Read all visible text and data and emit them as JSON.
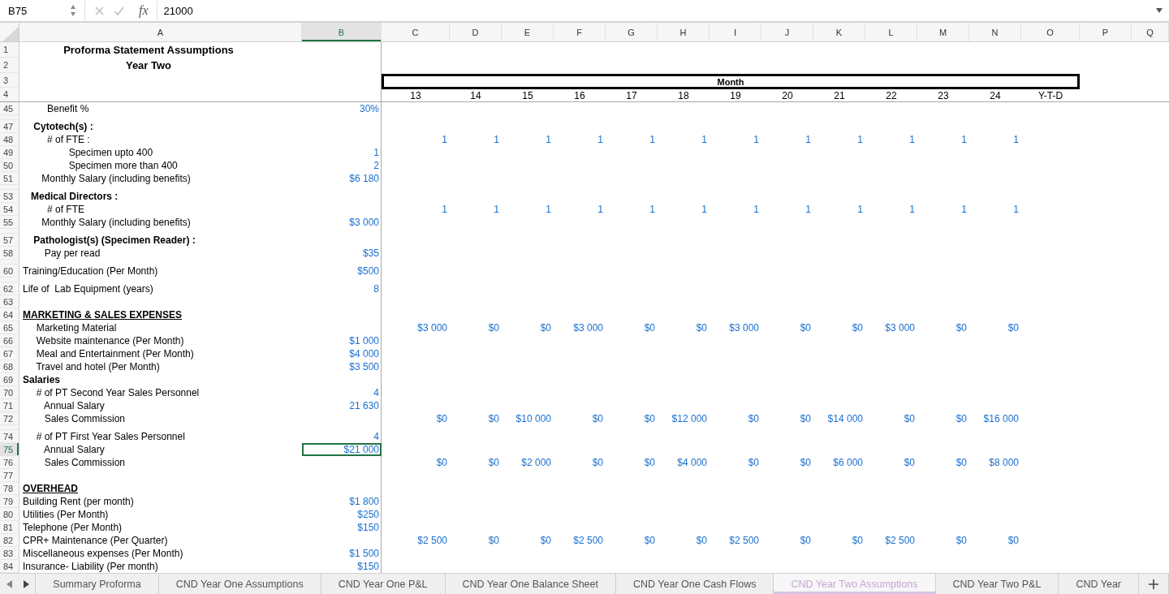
{
  "formula_bar": {
    "cell_ref": "B75",
    "fx_label": "fx",
    "formula": "21000"
  },
  "columns": [
    {
      "label": "A",
      "selected": false
    },
    {
      "label": "B",
      "selected": true
    },
    {
      "label": "C",
      "selected": false
    },
    {
      "label": "D",
      "selected": false
    },
    {
      "label": "E",
      "selected": false
    },
    {
      "label": "F",
      "selected": false
    },
    {
      "label": "G",
      "selected": false
    },
    {
      "label": "H",
      "selected": false
    },
    {
      "label": "I",
      "selected": false
    },
    {
      "label": "J",
      "selected": false
    },
    {
      "label": "K",
      "selected": false
    },
    {
      "label": "L",
      "selected": false
    },
    {
      "label": "M",
      "selected": false
    },
    {
      "label": "N",
      "selected": false
    },
    {
      "label": "O",
      "selected": false
    },
    {
      "label": "P",
      "selected": false
    },
    {
      "label": "Q",
      "selected": false
    }
  ],
  "frozen_rows": [
    {
      "num": "1",
      "kind": "title",
      "label": "Proforma Statement Assumptions",
      "selected": false
    },
    {
      "num": "2",
      "kind": "title",
      "label": "Year Two",
      "selected": false
    },
    {
      "num": "3",
      "kind": "month-band",
      "label": "Month",
      "selected": false
    },
    {
      "num": "4",
      "kind": "month-numbers",
      "months": [
        "13",
        "14",
        "15",
        "16",
        "17",
        "18",
        "19",
        "20",
        "21",
        "22",
        "23",
        "24"
      ],
      "ytd": "Y-T-D",
      "selected": false
    }
  ],
  "rows": [
    {
      "num": "45",
      "kind": "item",
      "label": "         Benefit %",
      "value": "30%",
      "selected": false
    },
    {
      "kind": "collapsed",
      "selected": false
    },
    {
      "num": "47",
      "kind": "group",
      "label": "    Cytotech(s) :",
      "selected": false
    },
    {
      "num": "48",
      "kind": "item",
      "label": "         # of FTE :",
      "months": [
        "1",
        "1",
        "1",
        "1",
        "1",
        "1",
        "1",
        "1",
        "1",
        "1",
        "1",
        "1"
      ],
      "selected": false
    },
    {
      "num": "49",
      "kind": "item",
      "label": "                 Specimen upto 400",
      "value": "1",
      "selected": false
    },
    {
      "num": "50",
      "kind": "item",
      "label": "                 Specimen more than 400",
      "value": "2",
      "selected": false
    },
    {
      "num": "51",
      "kind": "item",
      "label": "       Monthly Salary (including benefits)",
      "value": "$6 180",
      "selected": false
    },
    {
      "kind": "collapsed",
      "selected": false
    },
    {
      "num": "53",
      "kind": "group",
      "label": "   Medical Directors :",
      "selected": false
    },
    {
      "num": "54",
      "kind": "item",
      "label": "         # of FTE",
      "months": [
        "1",
        "1",
        "1",
        "1",
        "1",
        "1",
        "1",
        "1",
        "1",
        "1",
        "1",
        "1"
      ],
      "selected": false
    },
    {
      "num": "55",
      "kind": "item",
      "label": "       Monthly Salary (including benefits)",
      "value": "$3 000",
      "selected": false
    },
    {
      "kind": "collapsed",
      "selected": false
    },
    {
      "num": "57",
      "kind": "group",
      "label": "    Pathologist(s) (Specimen Reader) :",
      "selected": false
    },
    {
      "num": "58",
      "kind": "item",
      "label": "        Pay per read",
      "value": "$35",
      "selected": false
    },
    {
      "kind": "collapsed",
      "selected": false
    },
    {
      "num": "60",
      "kind": "item",
      "label": "Training/Education (Per Month)",
      "value": "$500",
      "selected": false
    },
    {
      "kind": "collapsed",
      "selected": false
    },
    {
      "num": "62",
      "kind": "item",
      "label": "Life of  Lab Equipment (years)",
      "value": "8",
      "selected": false
    },
    {
      "num": "63",
      "kind": "blank",
      "selected": false
    },
    {
      "num": "64",
      "kind": "section",
      "label": "MARKETING & SALES EXPENSES",
      "selected": false
    },
    {
      "num": "65",
      "kind": "item",
      "label": "     Marketing Material",
      "months": [
        "$3 000",
        "$0",
        "$0",
        "$3 000",
        "$0",
        "$0",
        "$3 000",
        "$0",
        "$0",
        "$3 000",
        "$0",
        "$0"
      ],
      "selected": false
    },
    {
      "num": "66",
      "kind": "item",
      "label": "     Website maintenance (Per Month)",
      "value": "$1 000",
      "selected": false
    },
    {
      "num": "67",
      "kind": "item",
      "label": "     Meal and Entertainment (Per Month)",
      "value": "$4 000",
      "selected": false
    },
    {
      "num": "68",
      "kind": "item",
      "label": "     Travel and hotel (Per Month)",
      "value": "$3 500",
      "selected": false
    },
    {
      "num": "69",
      "kind": "group",
      "label": "Salaries",
      "selected": false
    },
    {
      "num": "70",
      "kind": "item",
      "label": "     # of PT Second Year Sales Personnel",
      "value": "4",
      "selected": false
    },
    {
      "num": "71",
      "kind": "item",
      "label": "        Annual Salary",
      "value": "21 630",
      "selected": false
    },
    {
      "num": "72",
      "kind": "item",
      "label": "        Sales Commission",
      "months": [
        "$0",
        "$0",
        "$10 000",
        "$0",
        "$0",
        "$12 000",
        "$0",
        "$0",
        "$14 000",
        "$0",
        "$0",
        "$16 000"
      ],
      "selected": false
    },
    {
      "kind": "collapsed",
      "selected": false
    },
    {
      "num": "74",
      "kind": "item",
      "label": "     # of PT First Year Sales Personnel",
      "value": "4",
      "selected": false
    },
    {
      "num": "75",
      "kind": "item",
      "label": "        Annual Salary",
      "value": "$21 000",
      "selected": true
    },
    {
      "num": "76",
      "kind": "item",
      "label": "        Sales Commission",
      "months": [
        "$0",
        "$0",
        "$2 000",
        "$0",
        "$0",
        "$4 000",
        "$0",
        "$0",
        "$6 000",
        "$0",
        "$0",
        "$8 000"
      ],
      "selected": false
    },
    {
      "num": "77",
      "kind": "blank",
      "selected": false
    },
    {
      "num": "78",
      "kind": "section",
      "label": "OVERHEAD",
      "selected": false
    },
    {
      "num": "79",
      "kind": "item",
      "label": "Building Rent (per month)",
      "value": "$1 800",
      "selected": false
    },
    {
      "num": "80",
      "kind": "item",
      "label": "Utilities (Per Month)",
      "value": "$250",
      "selected": false
    },
    {
      "num": "81",
      "kind": "item",
      "label": "Telephone (Per Month)",
      "value": "$150",
      "selected": false
    },
    {
      "num": "82",
      "kind": "item",
      "label": "CPR+ Maintenance (Per Quarter)",
      "months": [
        "$2 500",
        "$0",
        "$0",
        "$2 500",
        "$0",
        "$0",
        "$2 500",
        "$0",
        "$0",
        "$2 500",
        "$0",
        "$0"
      ],
      "selected": false
    },
    {
      "num": "83",
      "kind": "item",
      "label": "Miscellaneous expenses (Per Month)",
      "value": "$1 500",
      "selected": false
    },
    {
      "num": "84",
      "kind": "item",
      "label": "Insurance- Liability (Per month)",
      "value": "$150",
      "selected": false
    }
  ],
  "sheet_tabs": [
    {
      "label": "Summary Proforma",
      "selected": false
    },
    {
      "label": "CND Year One Assumptions",
      "selected": false
    },
    {
      "label": "CND Year One P&L",
      "selected": false
    },
    {
      "label": "CND Year One Balance Sheet",
      "selected": false
    },
    {
      "label": "CND Year One Cash Flows",
      "selected": false
    },
    {
      "label": "CND Year Two Assumptions",
      "selected": true
    },
    {
      "label": "CND Year Two P&L",
      "selected": false
    },
    {
      "label": "CND Year",
      "selected": false
    }
  ]
}
